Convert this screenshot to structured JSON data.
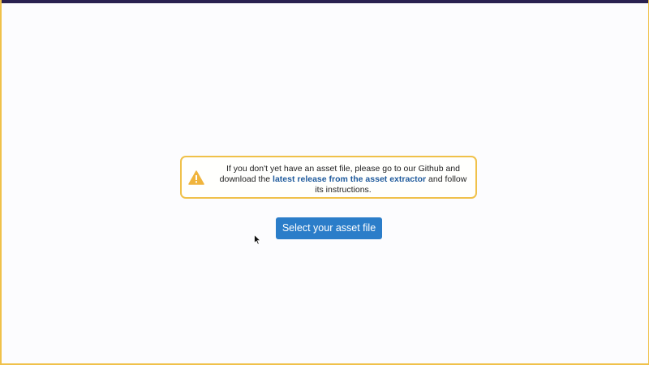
{
  "notice": {
    "text_before": "If you don't yet have an asset file, please go to our Github and download the ",
    "link_text": "latest release from the asset extractor",
    "text_after": " and follow its instructions.",
    "icon": "warning-icon",
    "border_color": "#f0c14a",
    "link_color": "#1f5a9c"
  },
  "actions": {
    "select_file_label": "Select your asset file",
    "button_color": "#2b7dc9"
  },
  "pointer": {
    "icon": "mouse-pointer-icon"
  }
}
